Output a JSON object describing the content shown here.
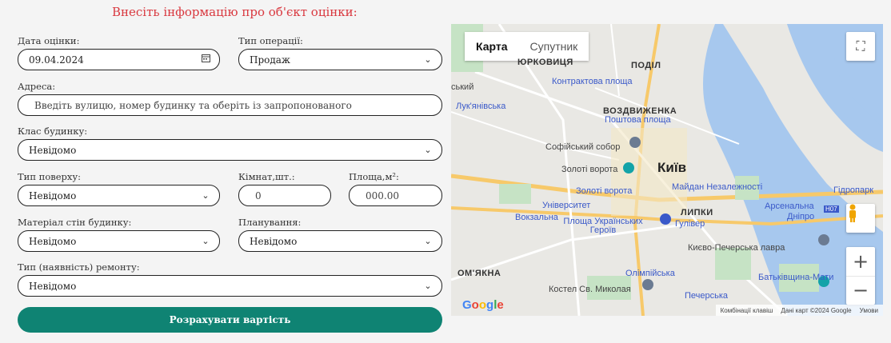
{
  "form": {
    "title": "Внесіть інформацію про об'єкт оцінки:",
    "date_label": "Дата оцінки:",
    "date_value": "09.04.2024",
    "operation_label": "Тип операції:",
    "operation_value": "Продаж",
    "address_label": "Адреса:",
    "address_placeholder": "Введіть вулицю, номер будинку та оберіть із запропонованого",
    "class_label": "Клас будинку:",
    "class_value": "Невідомо",
    "floor_type_label": "Тип поверху:",
    "floor_type_value": "Невідомо",
    "rooms_label": "Кімнат,шт.:",
    "rooms_placeholder": "0",
    "area_label": "Площа,м²:",
    "area_placeholder": "000.00",
    "wall_label": "Матеріал стін будинку:",
    "wall_value": "Невідомо",
    "layout_label": "Планування:",
    "layout_value": "Невідомо",
    "repair_label": "Тип (наявність) ремонту:",
    "repair_value": "Невідомо",
    "calc_button": "Розрахувати вартість"
  },
  "map": {
    "tab_map": "Карта",
    "tab_satellite": "Супутник",
    "city": "Київ",
    "labels": {
      "yurkovytsia": "ЮРКОВИЦЯ",
      "podil": "ПОДІЛ",
      "kontraktova": "Контрактова площа",
      "lukianivska": "Лук'янівська",
      "vozdvyzhenka": "ВОЗДВИЖЕНКА",
      "poshtova": "Поштова площа",
      "sofiiskyi": "Софійський собор",
      "zoloti_vorota_poi": "Золоті ворота",
      "zoloti_vorota_st": "Золоті ворота",
      "maidan": "Майдан Незалежності",
      "universytet": "Університет",
      "vokzalna": "Вокзальна",
      "ploshcha_heroiv": "Площа Українських Героїв",
      "gulliver": "Гулівер",
      "lypky": "ЛИПКИ",
      "arsenalna": "Арсенальна",
      "dnipro": "Дніпро",
      "hidropark": "Гідропарк",
      "lavra": "Києво-Печерська лавра",
      "omiakna": "ОМ'ЯКНА",
      "olimpiiska": "Олімпійська",
      "kostel": "Костел Св. Миколая",
      "pecherska": "Печерська",
      "batkivshchyna": "Батьківщина-Мати",
      "skyi": "ський",
      "h07": "H07"
    },
    "footer_keys": "Комбінації клавіш",
    "footer_data": "Дані карт ©2024 Google",
    "footer_terms": "Умови",
    "google": "Google"
  }
}
